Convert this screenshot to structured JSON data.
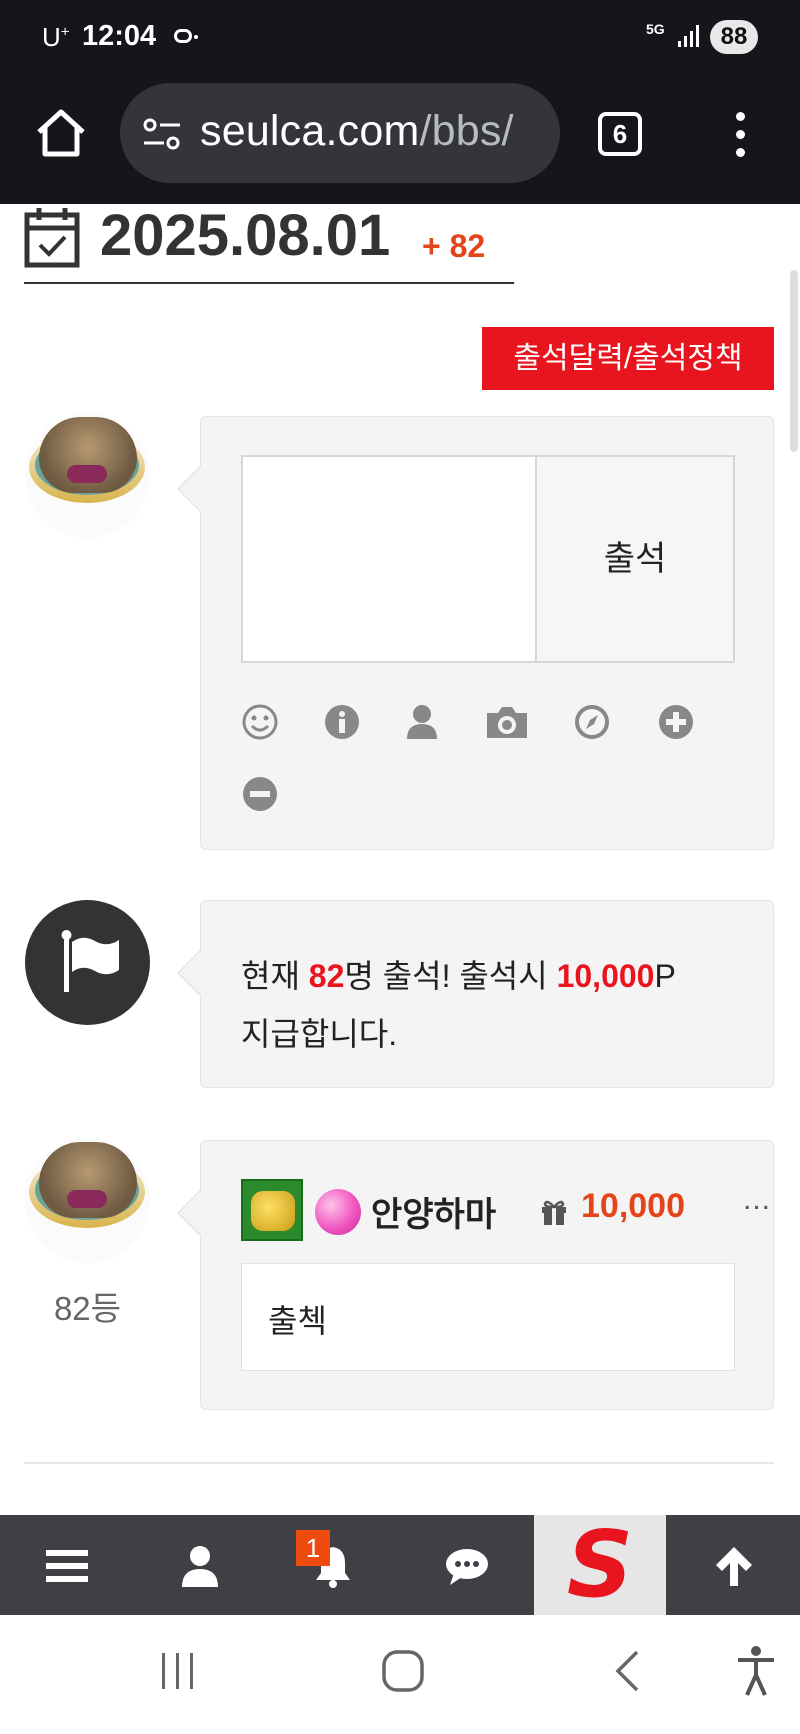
{
  "status_bar": {
    "carrier": "U",
    "carrier_sup": "+",
    "time": "12:04",
    "network": "5G",
    "battery": "88"
  },
  "browser": {
    "url_host": "seulca.com",
    "url_path": "/bbs/",
    "tab_count": "6"
  },
  "page": {
    "date": "2025.08.01",
    "date_count": "+ 82",
    "policy_button": "출석달력/출석정책",
    "comment_form": {
      "submit_label": "출석",
      "placeholder": ""
    },
    "toolbar_icons": [
      "smile-icon",
      "info-icon",
      "user-icon",
      "camera-icon",
      "compass-icon",
      "plus-circle-icon",
      "minus-circle-icon"
    ],
    "notice": {
      "prefix": "현재 ",
      "count": "82",
      "middle": "명 출석! 출석시 ",
      "points": "10,000",
      "suffix": "P",
      "line2": "지급합니다."
    },
    "entry": {
      "rank": "82등",
      "username": "안양하마",
      "points": "10,000",
      "more": "...",
      "comment": "출첵"
    }
  },
  "site_nav": {
    "items": [
      "menu-icon",
      "user-icon",
      "bell-icon",
      "chat-icon",
      "site-logo",
      "arrow-up-icon"
    ],
    "notification_badge": "1",
    "logo_letter": "S"
  },
  "colors": {
    "accent_red": "#e8141e",
    "accent_orange": "#e5441b",
    "bar_dark": "#15161b",
    "nav_dark": "#3f3f46"
  }
}
